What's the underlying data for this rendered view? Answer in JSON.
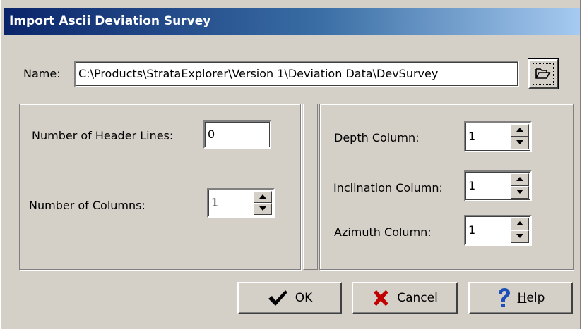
{
  "window": {
    "title": "Import Ascii Deviation Survey"
  },
  "name_row": {
    "label": "Name:",
    "value": "C:\\Products\\StrataExplorer\\Version 1\\Deviation Data\\DevSurvey",
    "browse_icon": "folder-open-icon"
  },
  "left_panel": {
    "header_lines_label": "Number of Header Lines:",
    "header_lines_value": "0",
    "columns_label": "Number of Columns:",
    "columns_value": "1"
  },
  "right_panel": {
    "depth_label": "Depth Column:",
    "depth_value": "1",
    "inclination_label": "Inclination Column:",
    "inclination_value": "1",
    "azimuth_label": "Azimuth Column:",
    "azimuth_value": "1"
  },
  "buttons": {
    "ok_label": "OK",
    "cancel_label": "Cancel",
    "help_label": "Help",
    "help_mnemonic": "H",
    "help_rest": "elp"
  },
  "colors": {
    "dialog_bg": "#d4d0c8",
    "title_start": "#0a246a",
    "title_end": "#a6caf0",
    "ok_check": "#000000",
    "cancel_x": "#c00000",
    "help_q": "#1c4fb8"
  }
}
